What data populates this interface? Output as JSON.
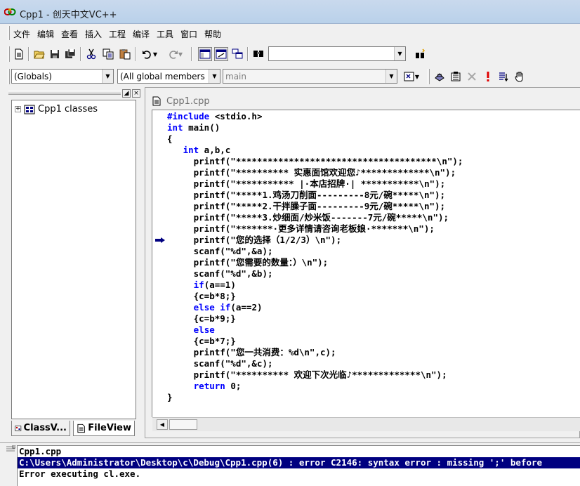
{
  "window": {
    "title": "Cpp1 - 创天中文VC++"
  },
  "menu": [
    "文件",
    "编辑",
    "查看",
    "插入",
    "工程",
    "编译",
    "工具",
    "窗口",
    "帮助"
  ],
  "toolbar": {
    "find_value": "",
    "globals_combo": "(Globals)",
    "members_combo": "(All global members",
    "function_combo": "main"
  },
  "workspace": {
    "tree_root": "Cpp1 classes",
    "tabs": [
      {
        "label": "ClassV...",
        "icon": "class-view-icon",
        "active": false
      },
      {
        "label": "FileView",
        "icon": "file-view-icon",
        "active": true
      }
    ]
  },
  "editor": {
    "file_name": "Cpp1.cpp",
    "breakpoint_line": 11,
    "lines": [
      "#include <stdio.h>",
      "int main()",
      "{",
      "   int a,b,c",
      "     printf(\"**************************************\\n\");",
      "     printf(\"********** 实惠面馆欢迎您♪*************\\n\");",
      "     printf(\"*********** |·本店招牌·| ***********\\n\");",
      "     printf(\"*****1.鸡汤刀削面---------8元/碗*****\\n\");",
      "     printf(\"*****2.干拌臊子面---------9元/碗*****\\n\");",
      "     printf(\"*****3.炒细面/炒米饭-------7元/碗*****\\n\");",
      "     printf(\"*******·更多详情请咨询老板娘·*******\\n\");",
      "     printf(\"您的选择（1/2/3）\\n\");",
      "     scanf(\"%d\",&a);",
      "     printf(\"您需要的数量：）\\n\");",
      "     scanf(\"%d\",&b);",
      "     if(a==1)",
      "     {c=b*8;}",
      "     else if(a==2)",
      "     {c=b*9;}",
      "     else",
      "     {c=b*7;}",
      "     printf(\"您一共消费：%d\\n\",c);",
      "     scanf(\"%d\",&c);",
      "     printf(\"********** 欢迎下次光临♪*************\\n\");",
      "     return 0;",
      "}"
    ]
  },
  "output": {
    "lines": [
      "Cpp1.cpp",
      "C:\\Users\\Administrator\\Desktop\\c\\Debug\\Cpp1.cpp(6) : error C2146: syntax error : missing ';' before",
      "Error executing cl.exe."
    ],
    "selected_line": 1
  }
}
